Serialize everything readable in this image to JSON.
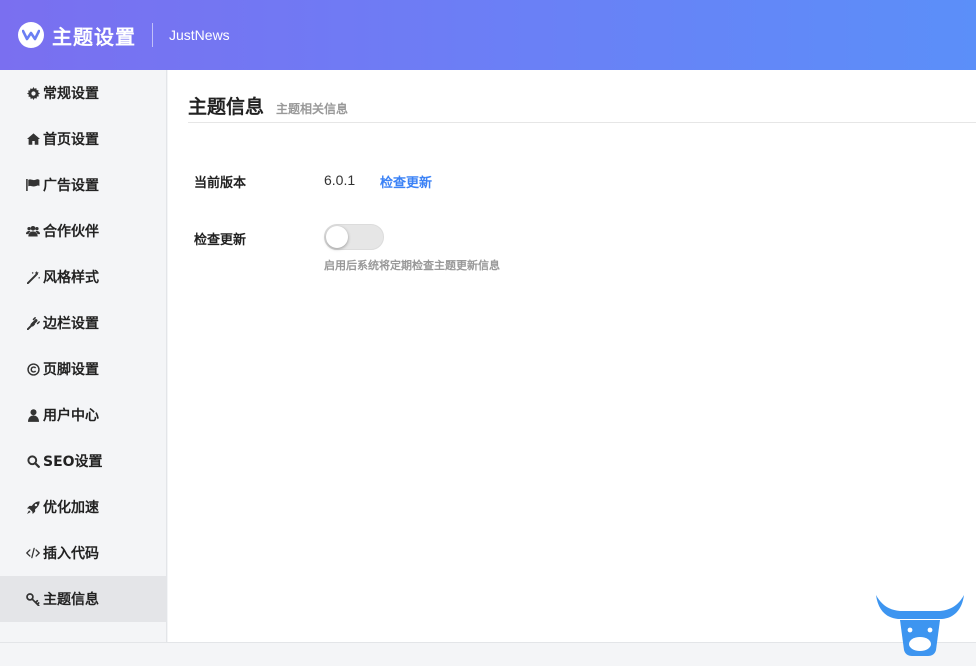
{
  "header": {
    "title": "主题设置",
    "subtitle": "JustNews",
    "logo_icon": "wechat-theme-logo-icon",
    "gradient": [
      "#7a6ff0",
      "#5b8ff9"
    ]
  },
  "sidebar": {
    "items": [
      {
        "label": "常规设置",
        "icon": "gear-icon"
      },
      {
        "label": "首页设置",
        "icon": "home-icon"
      },
      {
        "label": "广告设置",
        "icon": "flag-icon"
      },
      {
        "label": "合作伙伴",
        "icon": "users-icon"
      },
      {
        "label": "风格样式",
        "icon": "magic-wand-icon"
      },
      {
        "label": "边栏设置",
        "icon": "plug-icon"
      },
      {
        "label": "页脚设置",
        "icon": "copyright-icon"
      },
      {
        "label": "用户中心",
        "icon": "user-icon"
      },
      {
        "label": "SEO设置",
        "icon": "search-icon"
      },
      {
        "label": "优化加速",
        "icon": "rocket-icon"
      },
      {
        "label": "插入代码",
        "icon": "code-icon"
      },
      {
        "label": "主题信息",
        "icon": "key-icon",
        "active": true
      }
    ]
  },
  "main": {
    "title": "主题信息",
    "subtitle": "主题相关信息",
    "current_version_label": "当前版本",
    "current_version": "6.0.1",
    "check_update_link": "检查更新",
    "auto_update_label": "检查更新",
    "auto_update_enabled": false,
    "auto_update_hint": "启用后系统将定期检查主题更新信息"
  },
  "colors": {
    "accent": "#3b82f6",
    "active_item_bg": "#e4e5e8"
  },
  "mascot_icon": "bull-horns-icon"
}
